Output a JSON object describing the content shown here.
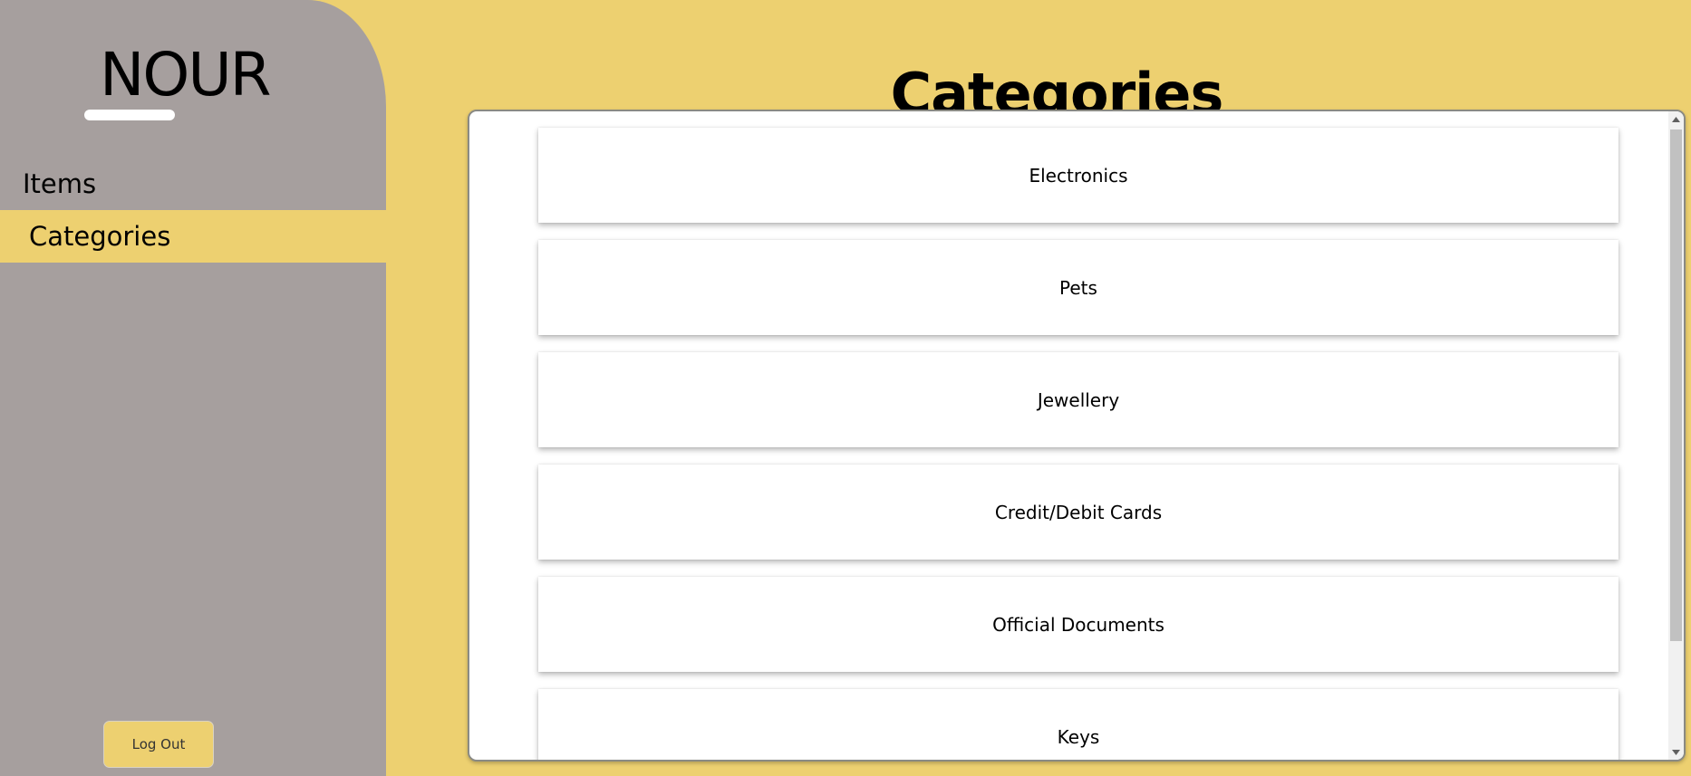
{
  "brand": {
    "name": "NOUR"
  },
  "sidebar": {
    "items": [
      {
        "label": "Items",
        "active": false
      },
      {
        "label": "Categories",
        "active": true
      }
    ],
    "logout_label": "Log Out"
  },
  "main": {
    "title": "Categories",
    "categories": [
      "Electronics",
      "Pets",
      "Jewellery",
      "Credit/Debit Cards",
      "Official Documents",
      "Keys"
    ]
  },
  "colors": {
    "background": "#EDD070",
    "sidebar": "#A69F9E",
    "card": "#FFFFFF",
    "active_nav": "#EDD070"
  },
  "icons": {
    "scroll_up": "scroll-up-arrow-icon",
    "scroll_down": "scroll-down-arrow-icon"
  }
}
